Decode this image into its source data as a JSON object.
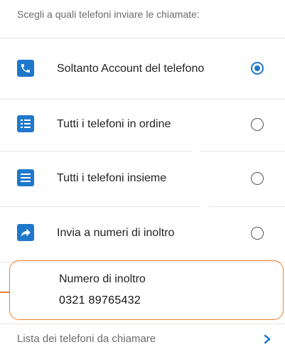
{
  "instruction": "Scegli a quali telefoni inviare le chiamate:",
  "options": [
    {
      "label": "Soltanto Account del telefono",
      "icon": "phone-icon",
      "selected": true
    },
    {
      "label": "Tutti i telefoni in ordine",
      "icon": "ordered-list-icon",
      "selected": false
    },
    {
      "label": "Tutti i telefoni insieme",
      "icon": "list-icon",
      "selected": false
    },
    {
      "label": "Invia a numeri di inoltro",
      "icon": "forward-arrow-icon",
      "selected": false
    }
  ],
  "forward_number": {
    "label": "Numero di inoltro",
    "value": "0321 89765432"
  },
  "phone_list_link": "Lista dei telefoni da chiamare",
  "colors": {
    "accent": "#1f78c9",
    "highlight": "#e8812f"
  }
}
